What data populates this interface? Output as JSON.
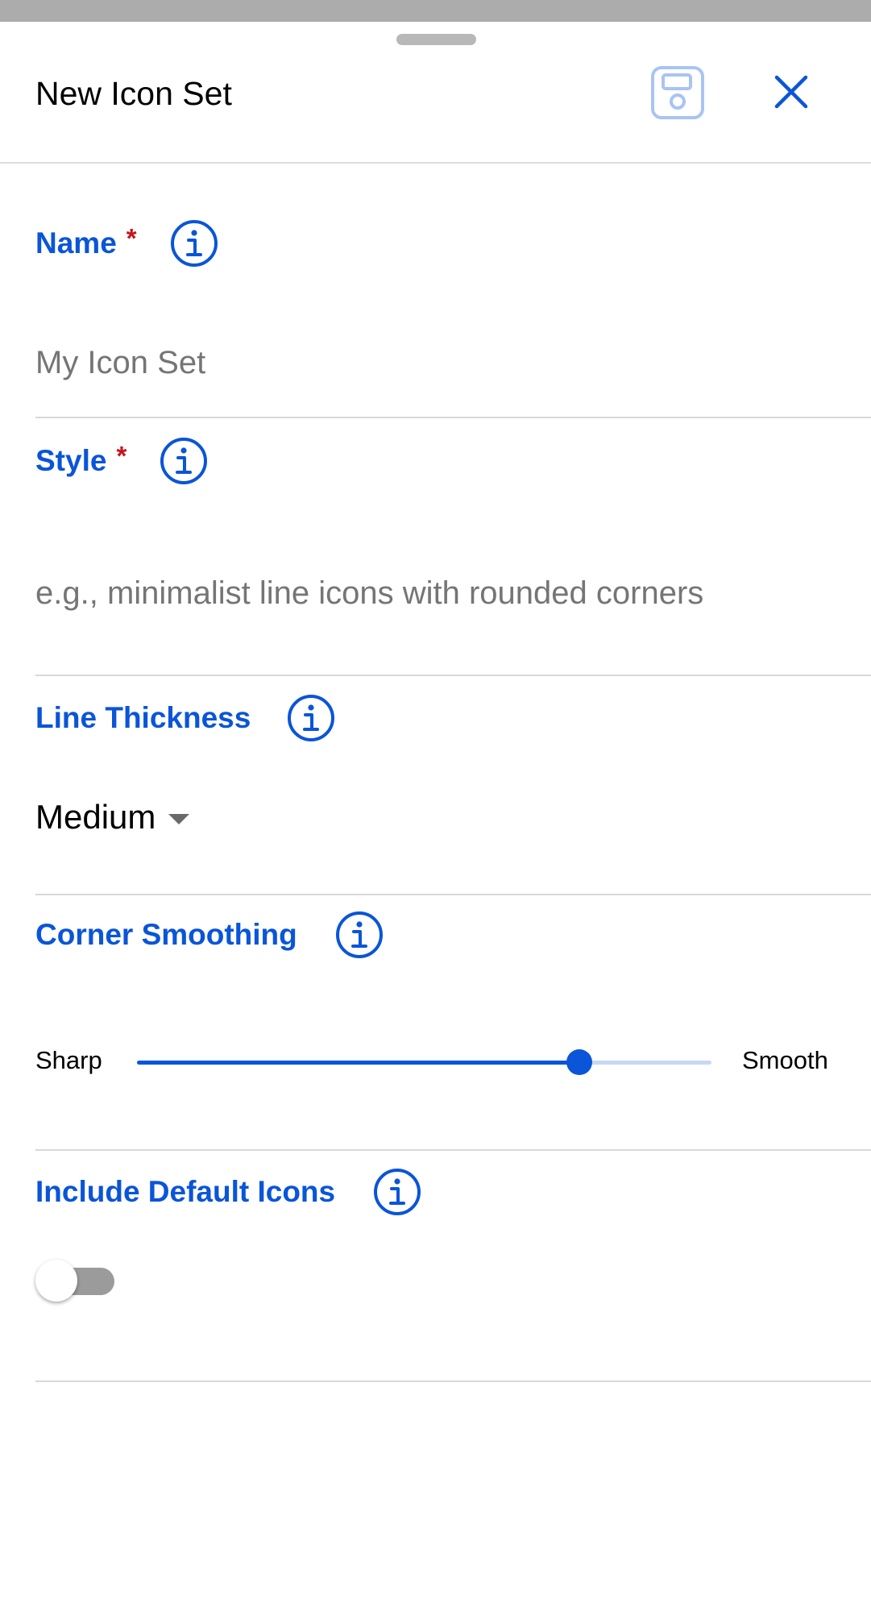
{
  "header": {
    "title": "New Icon Set"
  },
  "icons": {
    "save": "save-floppy-icon",
    "close": "close-x-icon",
    "info": "info-circle-icon",
    "dropdown": "caret-down-icon"
  },
  "colors": {
    "accent": "#0a55d8",
    "required": "#c4141b",
    "save_icon_disabled": "#a9c4f3",
    "track_inactive": "#c7d7f6",
    "toggle_off": "#9b9b9b"
  },
  "fields": {
    "name": {
      "label": "Name",
      "required_mark": "*",
      "value": "",
      "placeholder": "My Icon Set"
    },
    "style": {
      "label": "Style",
      "required_mark": "*",
      "value": "",
      "placeholder": "e.g., minimalist line icons with rounded corners"
    },
    "line_thickness": {
      "label": "Line Thickness",
      "selected": "Medium"
    },
    "corner_smoothing": {
      "label": "Corner Smoothing",
      "min_label": "Sharp",
      "max_label": "Smooth",
      "value_fraction": 0.77
    },
    "include_default_icons": {
      "label": "Include Default Icons",
      "enabled": false
    }
  }
}
